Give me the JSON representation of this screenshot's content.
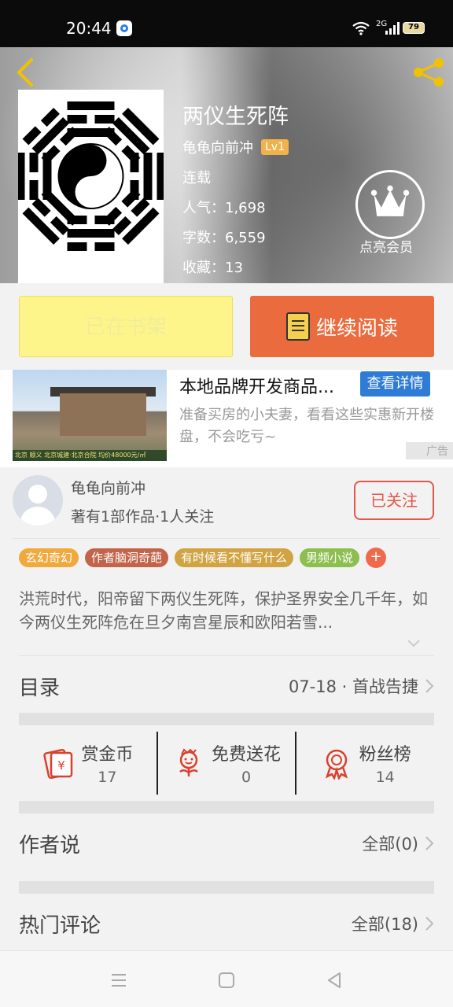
{
  "status_bar": {
    "time": "20:44",
    "network": "2G",
    "battery": "79"
  },
  "book": {
    "title": "两仪生死阵",
    "author": "龟龟向前冲",
    "level": "Lv1",
    "status": "连载",
    "popularity": "人气：1,698",
    "word_count": "字数：6,559",
    "favorites": "收藏：13",
    "vip_label": "点亮会员"
  },
  "actions": {
    "shelf_label": "已在书架",
    "read_label": "继续阅读"
  },
  "ad": {
    "title": "本地品牌开发商品...",
    "button": "查看详情",
    "description": "准备买房的小夫妻，看看这些实惠新开楼盘，不会吃亏~",
    "tag": "广告",
    "image_caption": "北京 顺义   北京城建·北京合院   均价48000元/㎡"
  },
  "author_section": {
    "name": "龟龟向前冲",
    "info": "著有1部作品·1人关注",
    "follow_label": "已关注"
  },
  "tags": [
    {
      "label": "玄幻奇幻",
      "color": "#f0a93c"
    },
    {
      "label": "作者脑洞奇葩",
      "color": "#c2634a"
    },
    {
      "label": "有时候看不懂写什么",
      "color": "#d1a342"
    },
    {
      "label": "男频小说",
      "color": "#8cbf4f"
    }
  ],
  "tag_more": "+",
  "summary": "洪荒时代，阳帝留下两仪生死阵，保护圣界安全几千年，如今两仪生死阵危在旦夕南宫星辰和欧阳若雪...",
  "catalog": {
    "label": "目录",
    "latest": "07-18 · 首战告捷"
  },
  "stats": [
    {
      "name": "赏金币",
      "value": "17",
      "icon": "red-envelope-icon"
    },
    {
      "name": "免费送花",
      "value": "0",
      "icon": "flower-icon"
    },
    {
      "name": "粉丝榜",
      "value": "14",
      "icon": "medal-icon"
    }
  ],
  "author_says": {
    "label": "作者说",
    "link": "全部(0)"
  },
  "hot_comments": {
    "label": "热门评论",
    "link": "全部(18)"
  },
  "colors": {
    "accent_orange": "#ea6b3e",
    "shelf_yellow": "#fdf58a",
    "follow_red": "#e3574a",
    "ad_blue": "#2e7cd6"
  }
}
